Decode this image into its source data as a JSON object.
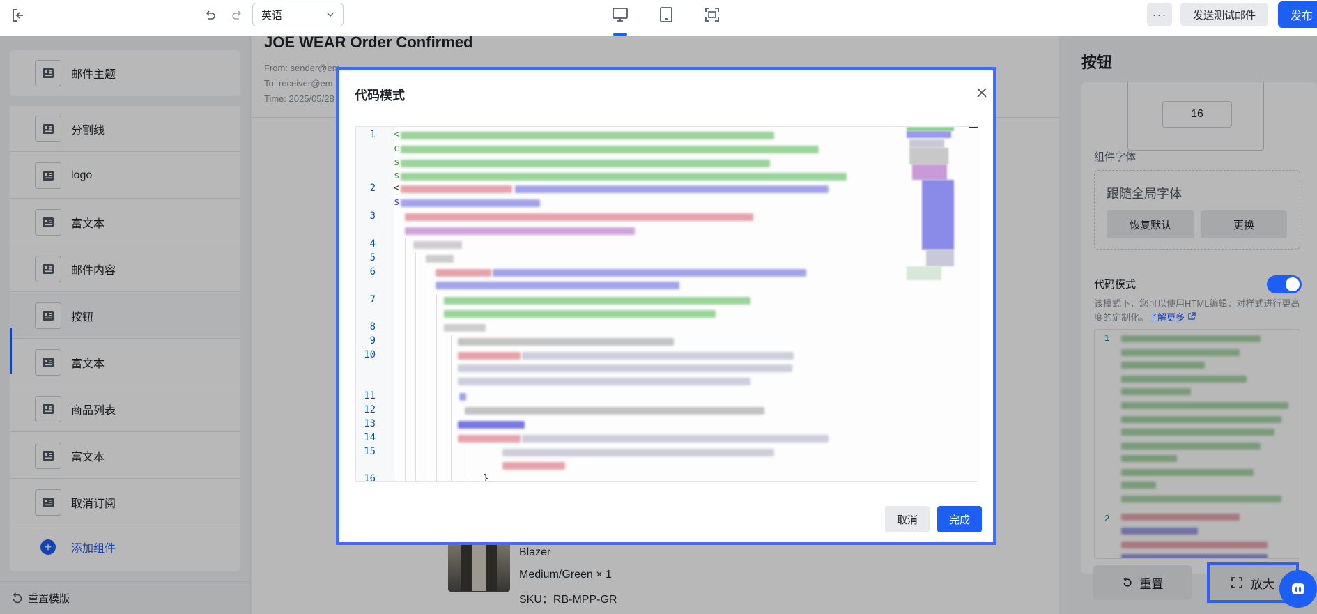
{
  "topbar": {
    "language": "英语",
    "more_label": "···",
    "test_mail_label": "发送测试邮件",
    "publish_label": "发布"
  },
  "sidebar": {
    "items": [
      {
        "label": "邮件主题"
      },
      {
        "label": "分割线"
      },
      {
        "label": "logo"
      },
      {
        "label": "富文本"
      },
      {
        "label": "邮件内容"
      },
      {
        "label": "按钮"
      },
      {
        "label": "富文本"
      },
      {
        "label": "商品列表"
      },
      {
        "label": "富文本"
      },
      {
        "label": "取消订阅"
      }
    ],
    "add_label": "添加组件",
    "reset_label": "重置模版"
  },
  "preview": {
    "subject": "JOE WEAR Order Confirmed",
    "from": "From: sender@em",
    "to": "To: receiver@em",
    "time": "Time: 2025/05/28",
    "product_name": "Blazer",
    "product_variant": "Medium/Green × 1",
    "product_sku": "SKU：RB-MPP-GR"
  },
  "right_panel": {
    "title": "按钮",
    "size_value": "16",
    "font_label": "组件字体",
    "font_value": "跟随全局字体",
    "restore_label": "恢复默认",
    "change_label": "更换",
    "code_mode_label": "代码模式",
    "code_mode_on": true,
    "code_desc": "该模式下，您可以使用HTML编辑，对样式进行更高度的定制化。",
    "learn_more": "了解更多",
    "mini_line_numbers": [
      "1",
      "2"
    ],
    "reset_label": "重置",
    "enlarge_label": "放大"
  },
  "modal": {
    "title": "代码模式",
    "line_numbers": [
      "1",
      "2",
      "3",
      "4",
      "5",
      "6",
      "7",
      "8",
      "9",
      "10",
      "11",
      "12",
      "13",
      "14",
      "15",
      "16"
    ],
    "code_starts": [
      "<",
      "c",
      "s",
      "s",
      "<",
      "s"
    ],
    "closing_brace": "}",
    "cancel_label": "取消",
    "done_label": "完成"
  },
  "colors": {
    "accent": "#1d5ff5",
    "modal_border": "#3d6cff",
    "line_number": "#0b5394",
    "code_green": "#3c9a3c",
    "code_blue": "#4a4ad8",
    "code_red": "#d94a5a"
  }
}
